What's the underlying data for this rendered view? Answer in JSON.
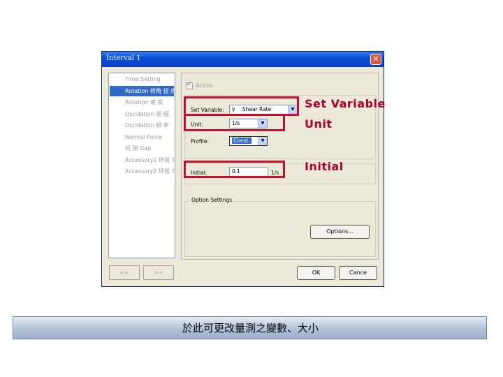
{
  "dialog": {
    "title": "Interval 1",
    "close_glyph": "✕",
    "nav_items": [
      {
        "label": "Time Setting",
        "selected": false
      },
      {
        "label": "Rotation 转角 扭 应",
        "selected": true
      },
      {
        "label": "Rotation 速 度",
        "selected": false
      },
      {
        "label": "Oscillation 振 幅",
        "selected": false
      },
      {
        "label": "Oscillation 频 率",
        "selected": false
      },
      {
        "label": "Normal Force",
        "selected": false
      },
      {
        "label": "间 隙 Gap",
        "selected": false
      },
      {
        "label": "Accessory1 环境 TEZ",
        "selected": false
      },
      {
        "label": "Accessory2 环境 TC",
        "selected": false
      }
    ],
    "back_label": "<<",
    "next_label": ">>",
    "active_label": "Active",
    "set_variable_label": "Set Variable:",
    "set_variable_symbol": "γ̇",
    "set_variable_value": "Shear Rate",
    "unit_label": "Unit:",
    "unit_value": "1/s",
    "profile_label": "Profile:",
    "profile_value": "Const.",
    "initial_label": "Initial:",
    "initial_value": "0.1",
    "initial_unit": "1/s",
    "option_settings_title": "Option Settings",
    "options_button": "Options...",
    "ok_button": "OK",
    "cancel_button": "Cance"
  },
  "annotations": {
    "set_variable": "Set Variable",
    "unit": "Unit",
    "initial": "Initial"
  },
  "caption": "於此可更改量測之變數、大小",
  "colors": {
    "highlight": "#c8102e",
    "annotation_text": "#b0002a",
    "title_bar": "#0a4fd6",
    "selection": "#316ac5"
  }
}
